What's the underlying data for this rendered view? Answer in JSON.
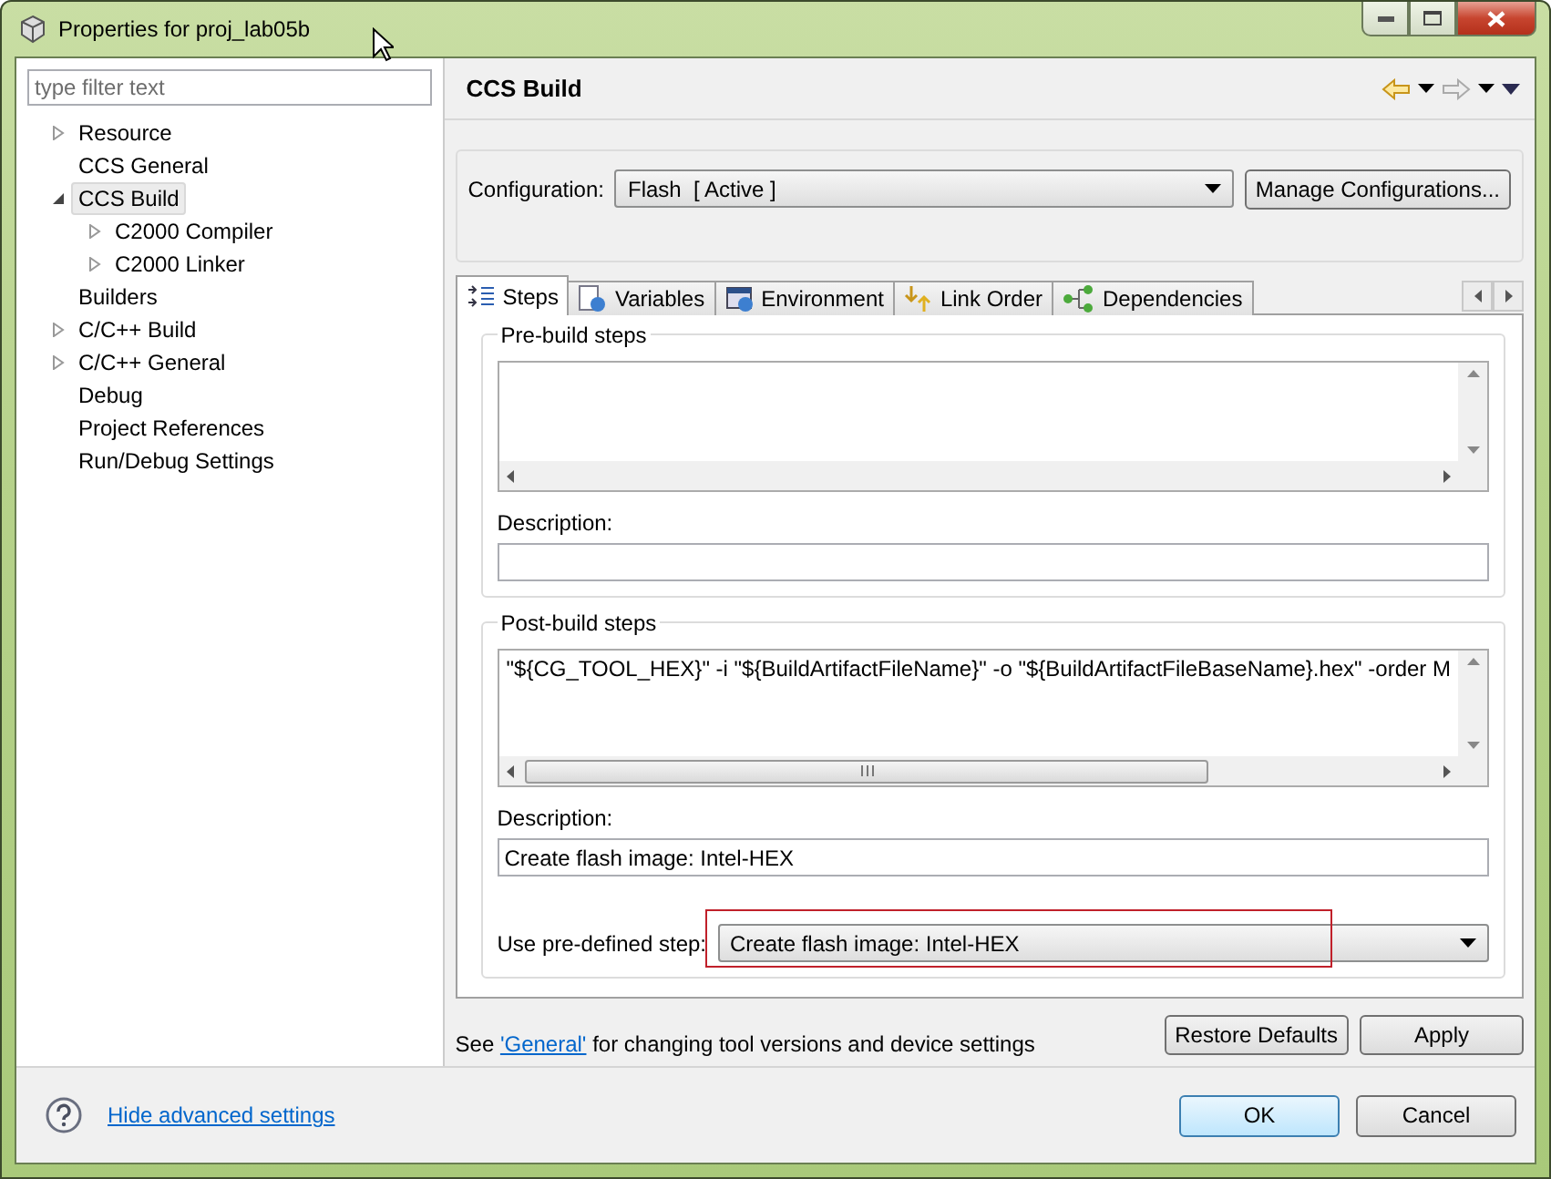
{
  "window": {
    "title": "Properties for proj_lab05b"
  },
  "sidebar": {
    "filter": {
      "placeholder": "type filter text"
    },
    "items": [
      {
        "label": "Resource",
        "expandable": true,
        "expanded": false,
        "selected": false
      },
      {
        "label": "CCS General",
        "expandable": false,
        "selected": false
      },
      {
        "label": "CCS Build",
        "expandable": true,
        "expanded": true,
        "selected": true,
        "children": [
          {
            "label": "C2000 Compiler",
            "expandable": true,
            "expanded": false,
            "selected": false
          },
          {
            "label": "C2000 Linker",
            "expandable": true,
            "expanded": false,
            "selected": false
          }
        ]
      },
      {
        "label": "Builders",
        "expandable": false,
        "selected": false
      },
      {
        "label": "C/C++ Build",
        "expandable": true,
        "expanded": false,
        "selected": false
      },
      {
        "label": "C/C++ General",
        "expandable": true,
        "expanded": false,
        "selected": false
      },
      {
        "label": "Debug",
        "expandable": false,
        "selected": false
      },
      {
        "label": "Project References",
        "expandable": false,
        "selected": false
      },
      {
        "label": "Run/Debug Settings",
        "expandable": false,
        "selected": false
      }
    ]
  },
  "page": {
    "title": "CCS Build",
    "configuration": {
      "label": "Configuration:",
      "value": "Flash  [ Active ]",
      "button": "Manage Configurations..."
    },
    "tabs": [
      {
        "label": "Steps",
        "selected": true
      },
      {
        "label": "Variables",
        "selected": false
      },
      {
        "label": "Environment",
        "selected": false
      },
      {
        "label": "Link Order",
        "selected": false
      },
      {
        "label": "Dependencies",
        "selected": false
      }
    ],
    "pre_build": {
      "title": "Pre-build steps",
      "description_label": "Description:"
    },
    "post_build": {
      "title": "Post-build steps",
      "command": "\"${CG_TOOL_HEX}\" -i \"${BuildArtifactFileName}\" -o \"${BuildArtifactFileBaseName}.hex\" -order M",
      "description_label": "Description:",
      "description": "Create flash image: Intel-HEX",
      "predefined_label": "Use pre-defined step:",
      "predefined": "Create flash image: Intel-HEX",
      "highlighted": true
    },
    "note": {
      "before": "See ",
      "link": "'General'",
      "after": " for changing tool versions and device settings"
    },
    "buttons": [
      "Restore Defaults",
      "Apply"
    ]
  },
  "footer": {
    "link": "Hide advanced settings",
    "buttons": [
      {
        "label": "OK",
        "default": true
      },
      {
        "label": "Cancel",
        "default": false
      }
    ]
  }
}
